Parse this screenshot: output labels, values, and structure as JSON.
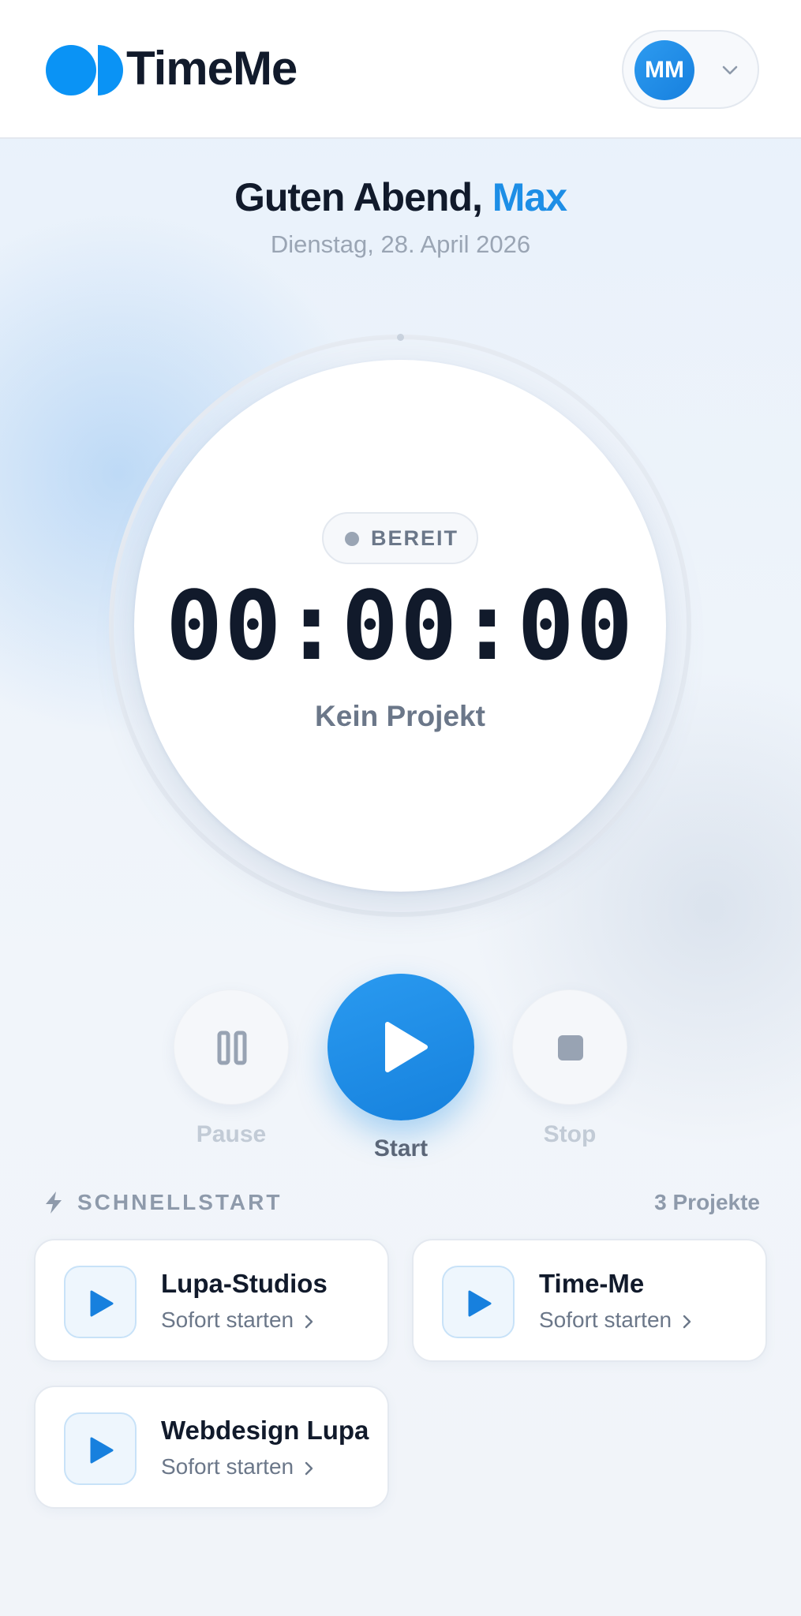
{
  "app": {
    "name": "TimeMe"
  },
  "user": {
    "initials": "MM"
  },
  "greeting": {
    "prefix": "Guten Abend, ",
    "name": "Max"
  },
  "date": "Dienstag, 28. April 2026",
  "timer": {
    "status": "BEREIT",
    "display": "00:00:00",
    "project": "Kein Projekt"
  },
  "controls": {
    "pause_label": "Pause",
    "start_label": "Start",
    "stop_label": "Stop"
  },
  "quickstart": {
    "title": "SCHNELLSTART",
    "count": "3 Projekte",
    "projects": [
      {
        "name": "Lupa-Studios",
        "action": "Sofort starten"
      },
      {
        "name": "Time-Me",
        "action": "Sofort starten"
      },
      {
        "name": "Webdesign Lupa",
        "action": "Sofort starten"
      }
    ]
  },
  "colors": {
    "accent": "#1d8ee6",
    "text": "#111a2b",
    "muted": "#6b7789"
  }
}
